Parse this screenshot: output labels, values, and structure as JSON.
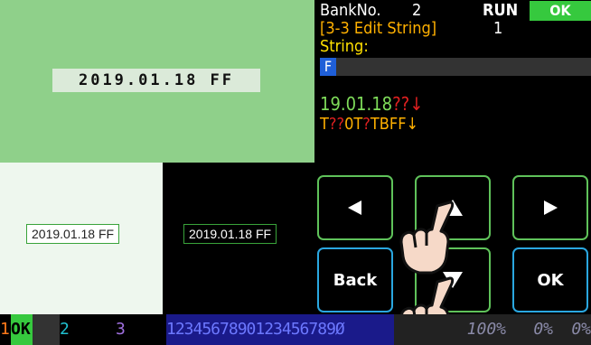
{
  "preview": {
    "green_text": "2019.01.18 FF",
    "white_text": "2019.01.18 FF",
    "black_text": "2019.01.18 FF"
  },
  "header": {
    "bank_label": "BankNo.",
    "bank_no": "2",
    "run_label": "RUN",
    "ok_label": "OK"
  },
  "editor": {
    "mode_title": "[3-3 Edit String]",
    "mode_number": "1",
    "string_label": "String:",
    "cursor_char": "F",
    "preview_line1_a": "19.01.18",
    "preview_line1_b": "??↓",
    "preview_line2_a": "T",
    "preview_line2_b": "??",
    "preview_line2_c": "0T",
    "preview_line2_d": "?",
    "preview_line2_e": "TBFF↓"
  },
  "buttons": {
    "back_label": "Back",
    "ok_label": "OK"
  },
  "status": {
    "slot1_num": "1",
    "slot1_ok": "OK",
    "slot2_num": "2",
    "slot3_num": "3",
    "digits": "1234567890123456789Ø",
    "percent1": "100%",
    "percent2": "0%",
    "percent3": "0%"
  },
  "colors": {
    "accent_green": "#36c93e",
    "button_green": "#5fc25a",
    "button_blue": "#2aa7e0",
    "mode_orange": "#ffb000",
    "label_yellow": "#ffe000",
    "cursor_blue": "#1f5fd8"
  },
  "icons": {
    "left": "left-arrow-icon",
    "up": "up-arrow-icon",
    "right": "right-arrow-icon",
    "down": "down-arrow-icon",
    "hand": "pointing-hand-icon"
  }
}
